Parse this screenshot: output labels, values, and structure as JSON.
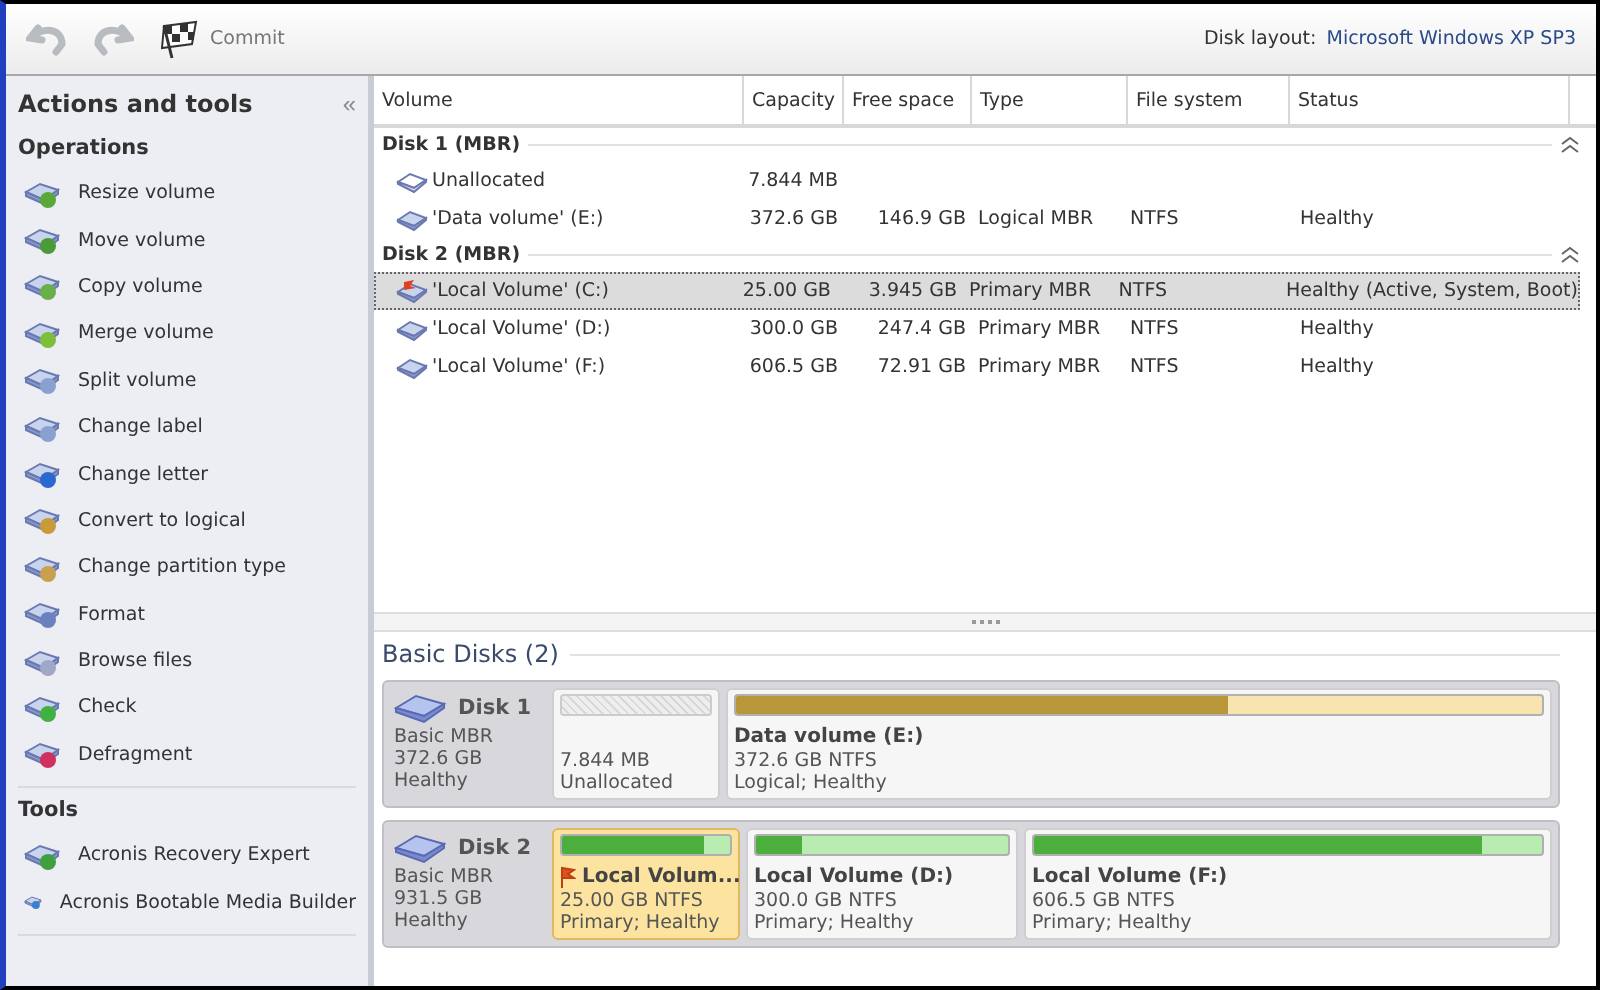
{
  "toolbar": {
    "undo": {
      "disabled": true
    },
    "redo": {
      "disabled": true
    },
    "commit": {
      "label": "Commit"
    },
    "layout_label": "Disk layout:",
    "layout_value": "Microsoft Windows XP SP3"
  },
  "sidebar": {
    "title": "Actions and tools",
    "collapse": "«",
    "sections": [
      {
        "title": "Operations",
        "items": [
          "Resize volume",
          "Move volume",
          "Copy volume",
          "Merge volume",
          "Split volume",
          "Change label",
          "Change letter",
          "Convert to logical",
          "Change partition type",
          "Format",
          "Browse files",
          "Check",
          "Defragment"
        ]
      },
      {
        "title": "Tools",
        "items": [
          "Acronis Recovery Expert",
          "Acronis Bootable Media Builder"
        ]
      }
    ]
  },
  "table": {
    "columns": [
      "Volume",
      "Capacity",
      "Free space",
      "Type",
      "File system",
      "Status"
    ],
    "groups": [
      {
        "title": "Disk 1 (MBR)",
        "expanded": true,
        "rows": [
          {
            "kind": "unallocated",
            "selected": false,
            "flag": false,
            "cells": [
              "Unallocated",
              "7.844 MB"
            ]
          },
          {
            "kind": "volume",
            "selected": false,
            "flag": false,
            "cells": [
              "'Data volume' (E:)",
              "372.6 GB",
              "146.9 GB",
              "Logical MBR",
              "NTFS",
              "Healthy"
            ]
          }
        ]
      },
      {
        "title": "Disk 2 (MBR)",
        "expanded": true,
        "rows": [
          {
            "kind": "volume",
            "selected": true,
            "flag": true,
            "cells": [
              "'Local Volume' (C:)",
              "25.00 GB",
              "3.945 GB",
              "Primary MBR",
              "NTFS",
              "Healthy (Active, System, Boot)"
            ]
          },
          {
            "kind": "volume",
            "selected": false,
            "flag": false,
            "cells": [
              "'Local Volume' (D:)",
              "300.0 GB",
              "247.4 GB",
              "Primary MBR",
              "NTFS",
              "Healthy"
            ]
          },
          {
            "kind": "volume",
            "selected": false,
            "flag": false,
            "cells": [
              "'Local Volume' (F:)",
              "606.5 GB",
              "72.91 GB",
              "Primary MBR",
              "NTFS",
              "Healthy"
            ]
          }
        ]
      }
    ]
  },
  "disk_map": {
    "title": "Basic Disks (2)",
    "disks": [
      {
        "name": "Disk 1",
        "type": "Basic MBR",
        "size": "372.6 GB",
        "status": "Healthy",
        "partitions": [
          {
            "kind": "unallocated",
            "selected": false,
            "flag": false,
            "size": "7.844 MB",
            "status": "Unallocated"
          },
          {
            "kind": "logical",
            "selected": false,
            "flag": false,
            "name": "Data volume (E:)",
            "size": "372.6 GB NTFS",
            "status": "Logical; Healthy",
            "level": 0.61
          }
        ]
      },
      {
        "name": "Disk 2",
        "type": "Basic MBR",
        "size": "931.5 GB",
        "status": "Healthy",
        "partitions": [
          {
            "kind": "primary",
            "selected": true,
            "flag": true,
            "name": "Local Volum...",
            "size": "25.00 GB NTFS",
            "status": "Primary; Healthy",
            "level": 0.84
          },
          {
            "kind": "primary",
            "selected": false,
            "flag": false,
            "name": "Local Volume (D:)",
            "size": "300.0 GB NTFS",
            "status": "Primary; Healthy",
            "level": 0.18
          },
          {
            "kind": "primary",
            "selected": false,
            "flag": false,
            "name": "Local Volume (F:)",
            "size": "606.5 GB NTFS",
            "status": "Primary; Healthy",
            "level": 0.88
          }
        ]
      }
    ]
  }
}
